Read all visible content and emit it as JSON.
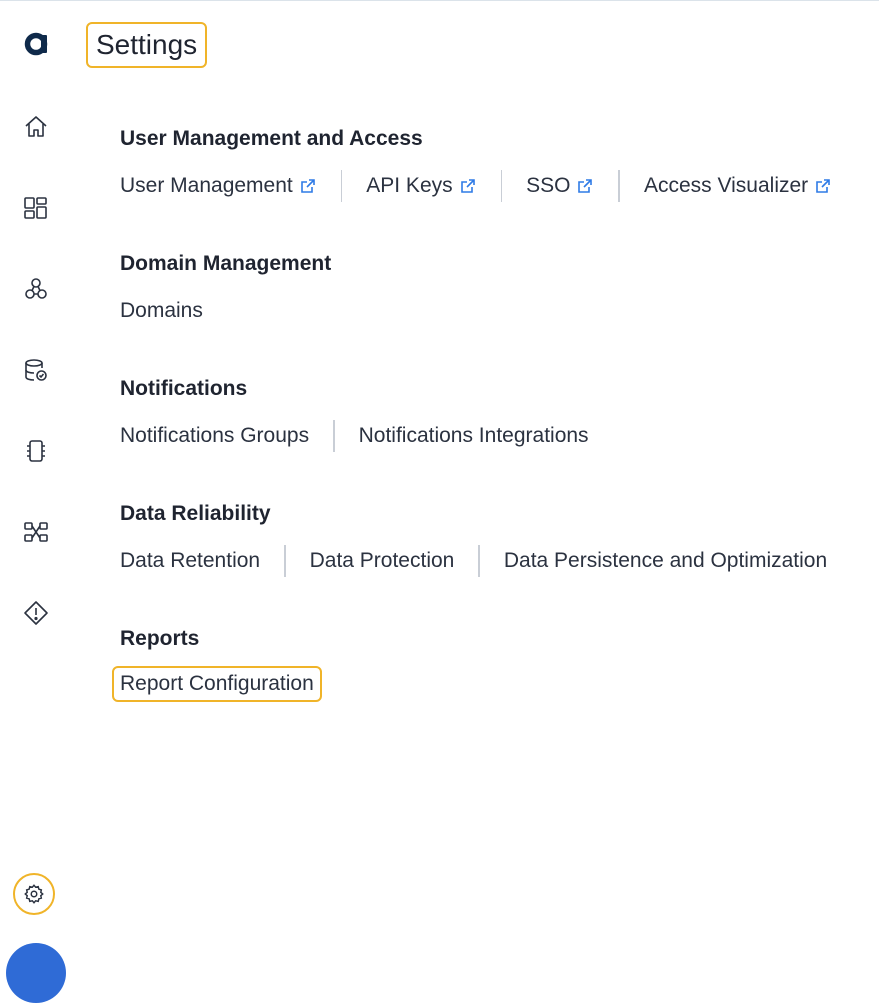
{
  "page_title": "Settings",
  "sidebar": {
    "logo_icon": "a-logo",
    "items": [
      {
        "icon": "home-icon"
      },
      {
        "icon": "dashboard-icon"
      },
      {
        "icon": "pipelines-icon"
      },
      {
        "icon": "database-check-icon"
      },
      {
        "icon": "chip-icon"
      },
      {
        "icon": "lineage-icon"
      },
      {
        "icon": "alert-diamond-icon"
      }
    ],
    "settings_icon": "gear-icon"
  },
  "sections": [
    {
      "title": "User Management and Access",
      "links": [
        {
          "label": "User Management",
          "external": true
        },
        {
          "label": "API Keys",
          "external": true
        },
        {
          "label": "SSO",
          "external": true
        },
        {
          "label": "Access Visualizer",
          "external": true
        }
      ]
    },
    {
      "title": "Domain Management",
      "links": [
        {
          "label": "Domains",
          "external": false
        }
      ]
    },
    {
      "title": "Notifications",
      "links": [
        {
          "label": "Notifications Groups",
          "external": false
        },
        {
          "label": "Notifications Integrations",
          "external": false
        }
      ]
    },
    {
      "title": "Data Reliability",
      "links": [
        {
          "label": "Data Retention",
          "external": false
        },
        {
          "label": "Data Protection",
          "external": false
        },
        {
          "label": "Data Persistence and Optimization",
          "external": false
        }
      ]
    },
    {
      "title": "Reports",
      "links": [
        {
          "label": "Report Configuration",
          "external": false
        }
      ]
    }
  ],
  "colors": {
    "highlight": "#f0b429",
    "brand": "#0f2a4a",
    "link_icon": "#2f7be6",
    "avatar": "#2f6bd6"
  }
}
